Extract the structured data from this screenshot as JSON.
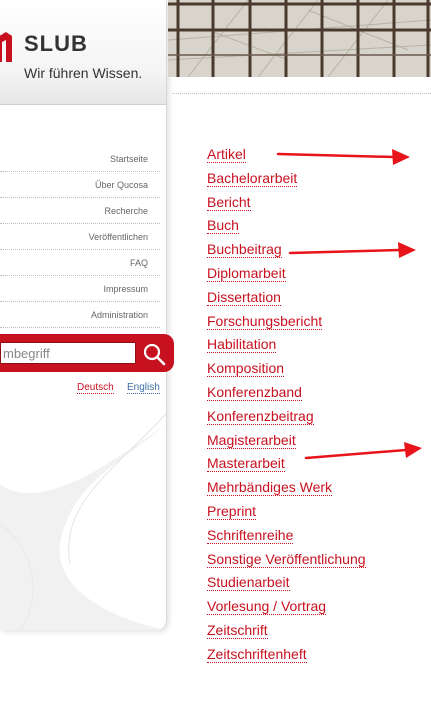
{
  "brand": {
    "name": "SLUB",
    "tagline": "Wir führen Wissen.",
    "logo_color": "#c8111f"
  },
  "nav": {
    "items": [
      {
        "label": "Startseite"
      },
      {
        "label": "Über Qucosa"
      },
      {
        "label": "Recherche"
      },
      {
        "label": "Veröffentlichen"
      },
      {
        "label": "FAQ"
      },
      {
        "label": "Impressum"
      },
      {
        "label": "Administration"
      }
    ]
  },
  "search": {
    "value": "mbegriff",
    "icon": "search-icon"
  },
  "languages": {
    "de": "Deutsch",
    "en": "English"
  },
  "document_types": [
    "Artikel",
    "Bachelorarbeit",
    "Bericht",
    "Buch",
    "Buchbeitrag",
    "Diplomarbeit",
    "Dissertation",
    "Forschungsbericht",
    "Habilitation",
    "Komposition",
    "Konferenzband",
    "Konferenzbeitrag",
    "Magisterarbeit",
    "Masterarbeit",
    "Mehrbändiges Werk",
    "Preprint",
    "Schriftenreihe",
    "Sonstige Veröffentlichung",
    "Studienarbeit",
    "Vorlesung / Vortrag",
    "Zeitschrift",
    "Zeitschriftenheft"
  ],
  "colors": {
    "accent": "#c8111f",
    "link_en": "#3a6ea5",
    "annotation_arrow": "#e8141c"
  }
}
